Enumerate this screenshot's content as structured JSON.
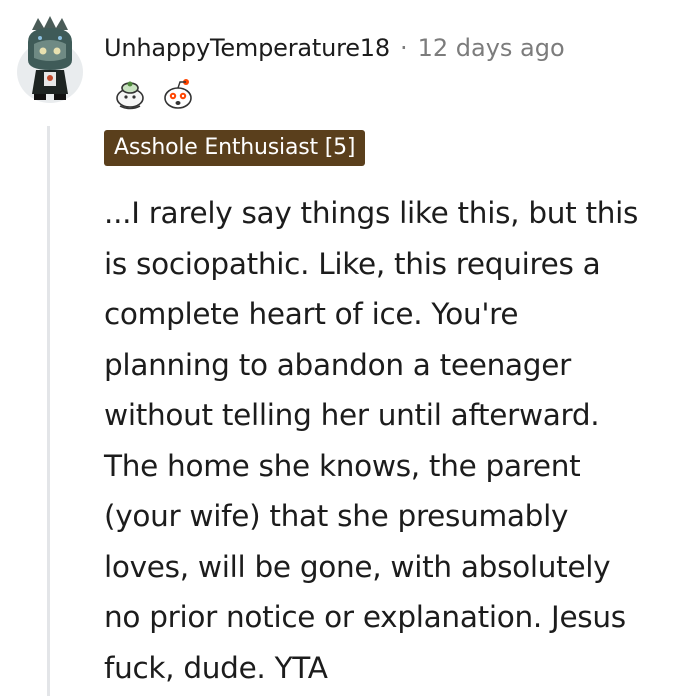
{
  "comment": {
    "author": "UnhappyTemperature18",
    "separator": "·",
    "timestamp": "12 days ago",
    "awards": [
      {
        "icon": "wholesome-seal-award-icon"
      },
      {
        "icon": "snoo-surprised-award-icon"
      }
    ],
    "flair": {
      "text": "Asshole Enthusiast [5]",
      "background": "#5a3f1c",
      "color": "#ffffff"
    },
    "body_lines": [
      "...I rarely say things like this, but this",
      "is sociopathic. Like, this requires a",
      "complete heart of ice. You're",
      "planning to abandon a teenager",
      "without telling her until afterward.",
      "The home she knows, the parent",
      "(your wife) that she presumably",
      "loves, will be gone, with absolutely",
      "no prior notice or explanation. Jesus",
      "fuck, dude. YTA"
    ]
  }
}
